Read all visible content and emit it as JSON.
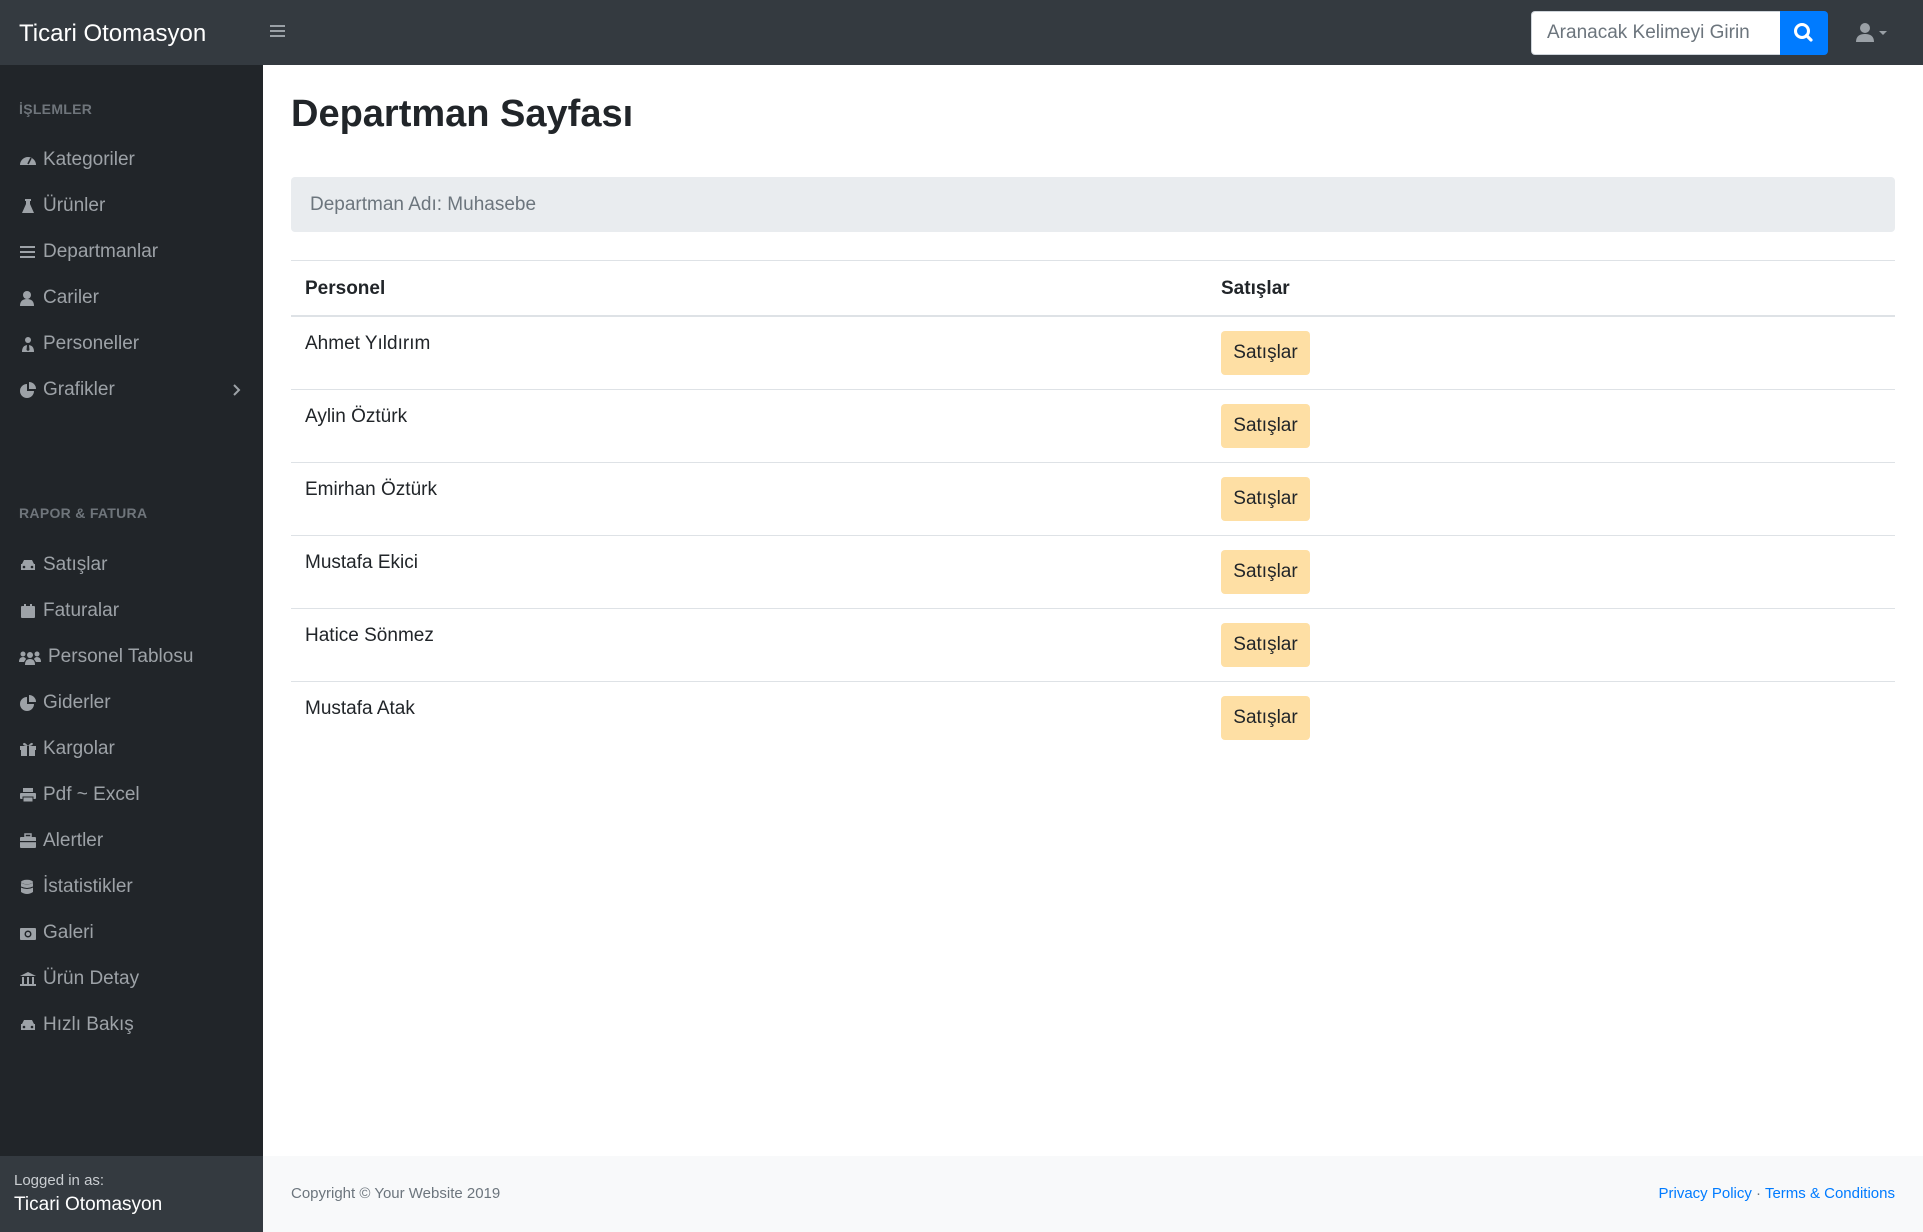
{
  "navbar": {
    "brand": "Ticari Otomasyon",
    "search_placeholder": "Aranacak Kelimeyi Girin"
  },
  "sidebar": {
    "heading_operations": "İŞLEMLER",
    "heading_reports": "RAPOR & FATURA",
    "items": [
      {
        "label": "Kategoriler",
        "icon": "tachometer-icon"
      },
      {
        "label": "Ürünler",
        "icon": "flask-icon"
      },
      {
        "label": "Departmanlar",
        "icon": "bars-icon"
      },
      {
        "label": "Cariler",
        "icon": "user-icon"
      },
      {
        "label": "Personeller",
        "icon": "user-tie-icon"
      },
      {
        "label": "Grafikler",
        "icon": "chart-pie-icon"
      },
      {
        "label": "Satışlar",
        "icon": "car-icon"
      },
      {
        "label": "Faturalar",
        "icon": "calendar-icon"
      },
      {
        "label": "Personel Tablosu",
        "icon": "people-icon"
      },
      {
        "label": "Giderler",
        "icon": "chart-pie-icon"
      },
      {
        "label": "Kargolar",
        "icon": "gift-icon"
      },
      {
        "label": "Pdf ~ Excel",
        "icon": "print-icon"
      },
      {
        "label": "Alertler",
        "icon": "briefcase-icon"
      },
      {
        "label": "İstatistikler",
        "icon": "database-icon"
      },
      {
        "label": "Galeri",
        "icon": "camera-icon"
      },
      {
        "label": "Ürün Detay",
        "icon": "bank-icon"
      },
      {
        "label": "Hızlı Bakış",
        "icon": "car-icon"
      }
    ],
    "logged_in_label": "Logged in as:",
    "logged_in_name": "Ticari Otomasyon"
  },
  "main": {
    "title": "Departman Sayfası",
    "department_label": "Departman Adı: Muhasebe",
    "table": {
      "headers": [
        "Personel",
        "Satışlar"
      ],
      "rows": [
        {
          "name": "Ahmet Yıldırım",
          "button": "Satışlar"
        },
        {
          "name": "Aylin Öztürk",
          "button": "Satışlar"
        },
        {
          "name": "Emirhan Öztürk",
          "button": "Satışlar"
        },
        {
          "name": "Mustafa Ekici",
          "button": "Satışlar"
        },
        {
          "name": "Hatice Sönmez",
          "button": "Satışlar"
        },
        {
          "name": "Mustafa Atak",
          "button": "Satışlar"
        }
      ]
    }
  },
  "footer": {
    "copyright": "Copyright © Your Website 2019",
    "privacy": "Privacy Policy",
    "separator": "·",
    "terms": "Terms & Conditions"
  },
  "colors": {
    "navbar": "#343a40",
    "sidebar": "#212529",
    "primary": "#007bff",
    "warning_button": "#fedfa4"
  }
}
